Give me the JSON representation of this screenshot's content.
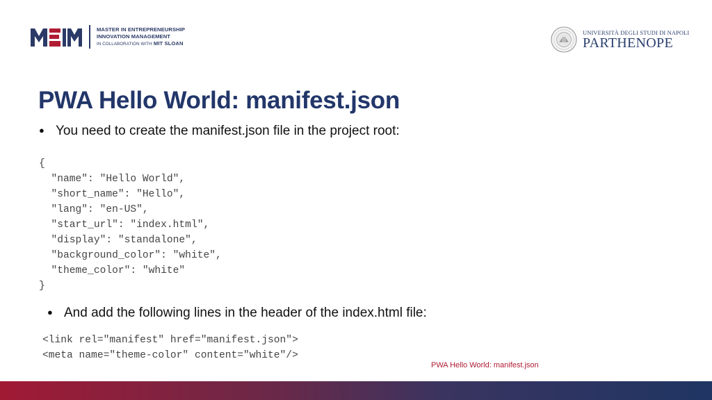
{
  "header": {
    "left_logo": {
      "mark": "MEIM",
      "line1": "MASTER IN ENTREPRENEURSHIP",
      "line2": "INNOVATION MANAGEMENT",
      "line3_prefix": "IN COLLABORATION WITH",
      "line3_strong": "MIT SLOAN",
      "color": "#2b3a67",
      "accent": "#b01c33"
    },
    "right_logo": {
      "top_line": "UNIVERSITÀ DEGLI STUDI DI NAPOLI",
      "name": "PARTHENOPE",
      "color": "#2a3f6e"
    }
  },
  "slide": {
    "title": "PWA Hello World: manifest.json",
    "bullet1": "You need to create the manifest.json file in the project root:",
    "code1": "{\n  \"name\": \"Hello World\",\n  \"short_name\": \"Hello\",\n  \"lang\": \"en-US\",\n  \"start_url\": \"index.html\",\n  \"display\": \"standalone\",\n  \"background_color\": \"white\",\n  \"theme_color\": \"white\"\n}",
    "bullet2": "And add the following lines in the header of the index.html file:",
    "code2": "<link rel=\"manifest\" href=\"manifest.json\">\n<meta name=\"theme-color\" content=\"white\"/>",
    "bullet_glyph": "●"
  },
  "footer": {
    "label": "PWA Hello World: manifest.json",
    "bar_colors": [
      "#a11a34",
      "#1f3563"
    ]
  }
}
